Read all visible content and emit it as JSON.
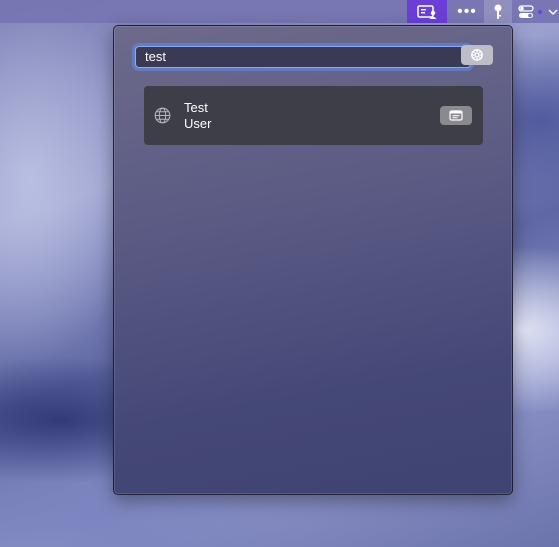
{
  "menubar": {
    "items": [
      {
        "icon": "contact-card-icon",
        "active": true
      },
      {
        "icon": "more-icon",
        "label": "•••"
      },
      {
        "icon": "key-icon"
      },
      {
        "icon": "toggles-icon"
      },
      {
        "icon": "dot-icon"
      },
      {
        "icon": "chevron-icon"
      }
    ],
    "accent": "#6b3fd6"
  },
  "search": {
    "value": "test",
    "placeholder": ""
  },
  "results": [
    {
      "icon": "globe-icon",
      "line1": "Test",
      "line2": "User",
      "action_icon": "window-icon"
    }
  ]
}
